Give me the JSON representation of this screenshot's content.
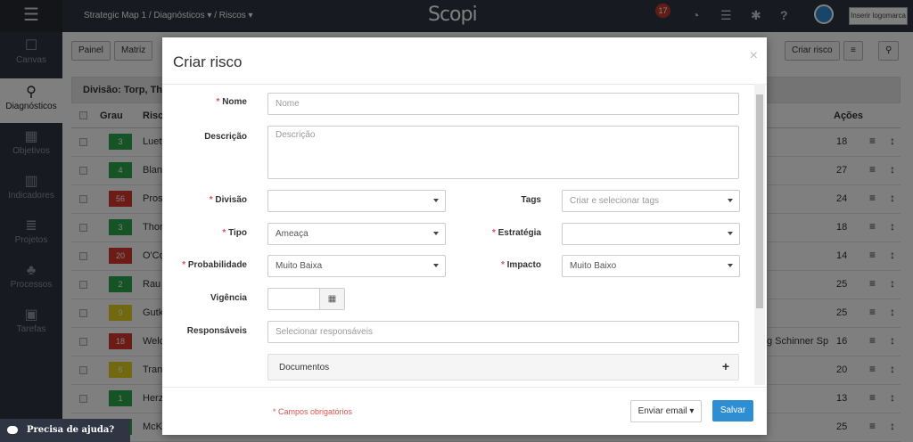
{
  "topbar": {
    "breadcrumb": "Strategic Map 1 / Diagnósticos ▾ / Riscos ▾",
    "brand": "Scopi",
    "notifications": "17",
    "logo_button": "Inserir logomarca"
  },
  "sidebar": {
    "items": [
      {
        "label": "Canvas",
        "icon": "canvas-icon"
      },
      {
        "label": "Diagnósticos",
        "icon": "search-icon"
      },
      {
        "label": "Objetivos",
        "icon": "grid-icon"
      },
      {
        "label": "Indicadores",
        "icon": "chart-icon"
      },
      {
        "label": "Projetos",
        "icon": "stack-icon"
      },
      {
        "label": "Processos",
        "icon": "hierarchy-icon"
      },
      {
        "label": "Tarefas",
        "icon": "calendar-icon"
      }
    ]
  },
  "toolbar": {
    "painel": "Painel",
    "matriz": "Matriz",
    "criar_risco": "Criar risco"
  },
  "table": {
    "division": "Divisão: Torp, Thomp",
    "col_grau": "Grau",
    "col_risco": "Risco",
    "col_acoes": "Ações",
    "rows": [
      {
        "grade": "3",
        "color": "#2ea84a",
        "name": "Luett",
        "count": "18"
      },
      {
        "grade": "4",
        "color": "#2ea84a",
        "name": "Bland",
        "count": "27"
      },
      {
        "grade": "56",
        "color": "#d9362f",
        "name": "Prosa",
        "count": "24"
      },
      {
        "grade": "3",
        "color": "#2ea84a",
        "name": "Thom",
        "count": "18"
      },
      {
        "grade": "20",
        "color": "#d9362f",
        "name": "O'Co",
        "count": "14"
      },
      {
        "grade": "2",
        "color": "#2ea84a",
        "name": "Rau I",
        "count": "25"
      },
      {
        "grade": "9",
        "color": "#e2d11f",
        "name": "Gutk",
        "count": "25"
      },
      {
        "grade": "18",
        "color": "#d9362f",
        "name": "Welc",
        "count": "16",
        "extra": "g Schinner Sp"
      },
      {
        "grade": "6",
        "color": "#e2d11f",
        "name": "Trant",
        "count": "20"
      },
      {
        "grade": "1",
        "color": "#2ea84a",
        "name": "Herzo",
        "count": "13"
      },
      {
        "grade": "",
        "color": "#2ea84a",
        "name": "McKe",
        "count": "25"
      }
    ]
  },
  "help": "Precisa de ajuda?",
  "modal": {
    "title": "Criar risco",
    "close": "×",
    "nome_label": "Nome",
    "nome_placeholder": "Nome",
    "descricao_label": "Descrição",
    "descricao_placeholder": "Descrição",
    "divisao_label": "Divisão",
    "tags_label": "Tags",
    "tags_placeholder": "Criar e selecionar tags",
    "tipo_label": "Tipo",
    "tipo_value": "Ameaça",
    "estrategia_label": "Estratégia",
    "probabilidade_label": "Probabilidade",
    "probabilidade_value": "Muito Baixa",
    "impacto_label": "Impacto",
    "impacto_value": "Muito Baixo",
    "vigencia_label": "Vigência",
    "responsaveis_label": "Responsáveis",
    "responsaveis_placeholder": "Selecionar responsáveis",
    "documentos": "Documentos",
    "required_note": "* Campos obrigatórios",
    "email_button": "Enviar email ▾",
    "save_button": "Salvar"
  }
}
